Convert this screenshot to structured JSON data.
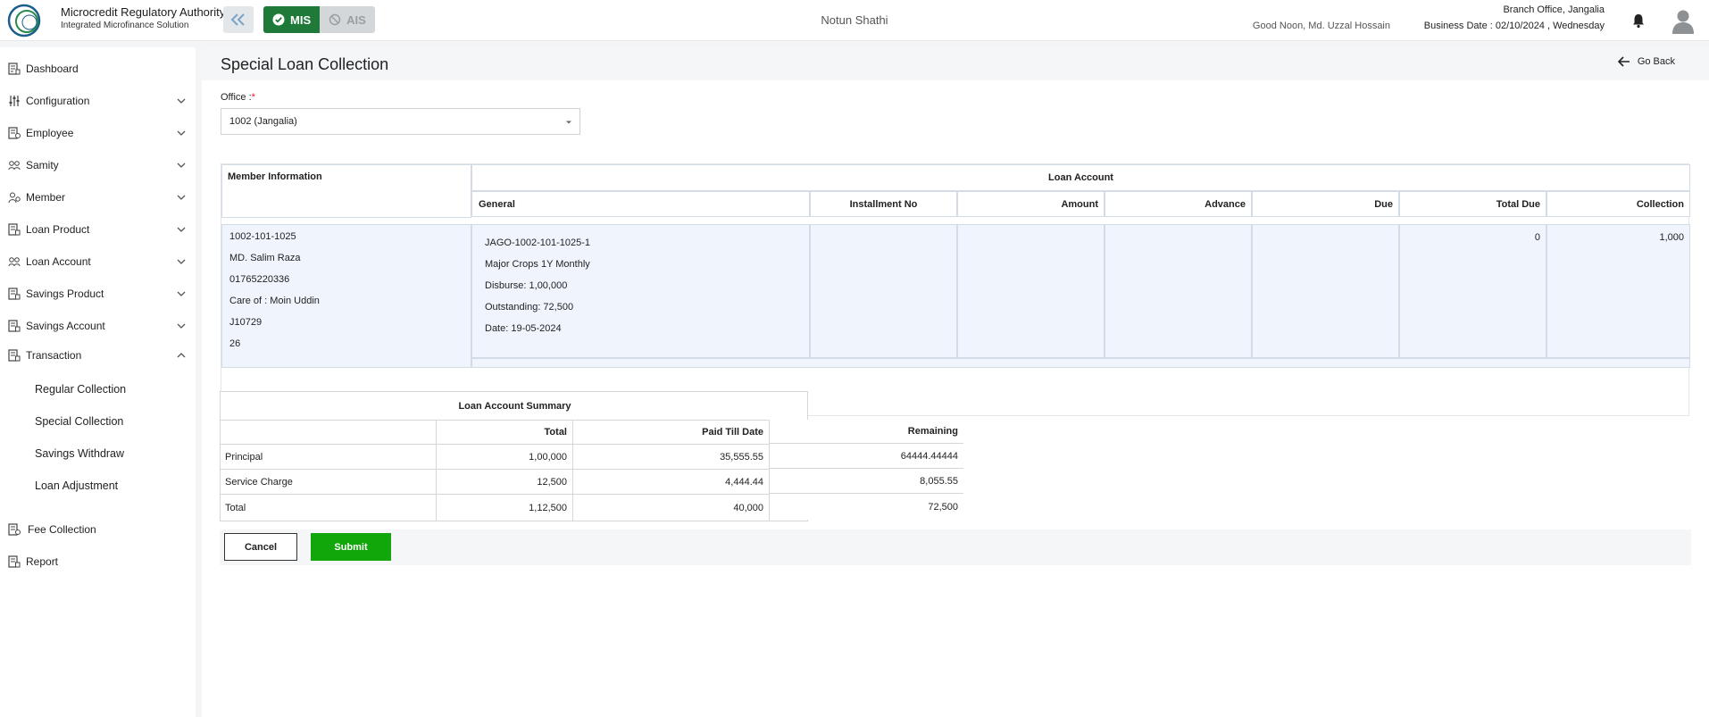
{
  "header": {
    "org_title": "Microcredit Regulatory Authority",
    "org_subtitle": "Integrated Microfinance Solution",
    "logo_text": "Microcredit Regulatory Authority",
    "mode_mis": "MIS",
    "mode_ais": "AIS",
    "app_name": "Notun Shathi",
    "greeting": "Good Noon, Md. Uzzal Hossain",
    "branch": "Branch Office, Jangalia",
    "business_date": "Business Date : 02/10/2024 , Wednesday",
    "accent_color": "#1f7a3a"
  },
  "sidebar": {
    "items": [
      {
        "label": "Dashboard",
        "icon": "dashboard-icon"
      },
      {
        "label": "Configuration",
        "icon": "sliders-icon"
      },
      {
        "label": "Employee",
        "icon": "employee-icon"
      },
      {
        "label": "Samity",
        "icon": "samity-icon"
      },
      {
        "label": "Member",
        "icon": "member-icon"
      },
      {
        "label": "Loan Product",
        "icon": "loan-product-icon"
      },
      {
        "label": "Loan Account",
        "icon": "loan-account-icon"
      },
      {
        "label": "Savings Product",
        "icon": "savings-product-icon"
      },
      {
        "label": "Savings Account",
        "icon": "savings-account-icon"
      },
      {
        "label": "Transaction",
        "icon": "transaction-icon"
      },
      {
        "label": "Fee Collection",
        "icon": "fee-collection-icon"
      },
      {
        "label": "Report",
        "icon": "report-icon"
      }
    ],
    "transaction_sub": [
      "Regular Collection",
      "Special Collection",
      "Savings Withdraw",
      "Loan Adjustment"
    ]
  },
  "page": {
    "title": "Special Loan Collection",
    "go_back": "Go Back",
    "office_label": "Office :",
    "office_required": "*",
    "office_value": "1002 (Jangalia)"
  },
  "grid": {
    "member_header": "Member Information",
    "loan_header": "Loan Account",
    "columns": [
      "General",
      "Installment No",
      "Amount",
      "Advance",
      "Due",
      "Total Due",
      "Collection"
    ],
    "member": [
      "1002-101-1025",
      "MD. Salim Raza",
      "01765220336",
      "Care of : Moin Uddin",
      "J10729",
      "26"
    ],
    "general": [
      "JAGO-1002-101-1025-1",
      "Major Crops 1Y Monthly",
      "Disburse: 1,00,000",
      "Outstanding: 72,500",
      "Date: 19-05-2024"
    ],
    "total_due": "0",
    "collection": "1,000"
  },
  "summary": {
    "title": "Loan Account Summary",
    "columns": [
      "Total",
      "Paid Till Date",
      "Remaining"
    ],
    "rows": [
      {
        "label": "Principal",
        "total": "1,00,000",
        "paid": "35,555.55",
        "remaining": "64444.44444"
      },
      {
        "label": "Service Charge",
        "total": "12,500",
        "paid": "4,444.44",
        "remaining": "8,055.55"
      },
      {
        "label": "Total",
        "total": "1,12,500",
        "paid": "40,000",
        "remaining": "72,500"
      }
    ]
  },
  "actions": {
    "cancel": "Cancel",
    "submit": "Submit",
    "submit_color": "#11a70b"
  }
}
